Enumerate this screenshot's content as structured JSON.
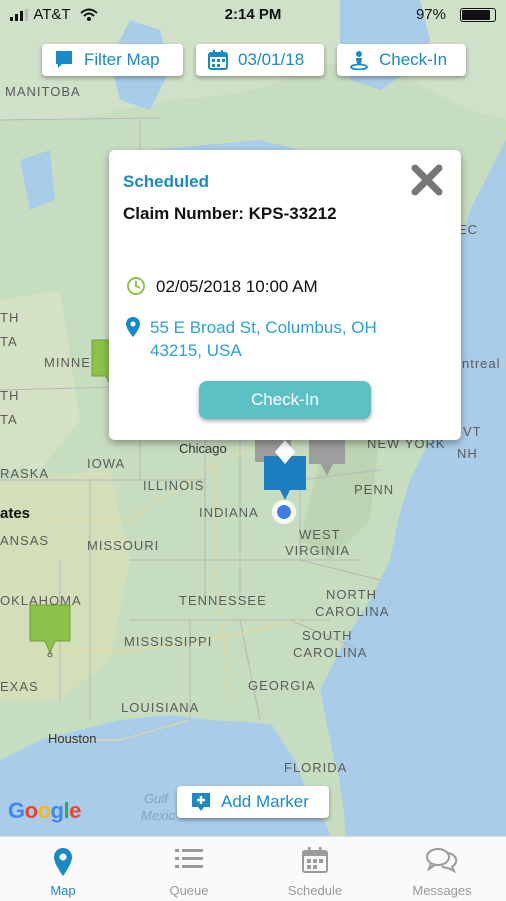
{
  "status_bar": {
    "carrier": "AT&T",
    "time": "2:14 PM",
    "battery": "97%"
  },
  "top_buttons": {
    "filter": "Filter Map",
    "date": "03/01/18",
    "checkin": "Check-In"
  },
  "map_labels": {
    "manitoba": "MANITOBA",
    "minne": "MINNE",
    "chicago": "Chicago",
    "iowa": "IOWA",
    "illinois": "ILLINOIS",
    "indiana": "INDIANA",
    "raska": "RASKA",
    "ates": "ates",
    "ansas": "ANSAS",
    "missouri": "MISSOURI",
    "oklahoma": "OKLAHOMA",
    "tennessee": "TENNESSEE",
    "mississippi": "MISSISSIPPI",
    "exas": "EXAS",
    "louisiana": "LOUISIANA",
    "houston": "Houston",
    "georgia": "GEORGIA",
    "florida": "FLORIDA",
    "penn": "PENN",
    "west": "WEST",
    "virginia": "VIRGINIA",
    "north": "NORTH",
    "ncarolina": "CAROLINA",
    "south": "SOUTH",
    "scarolina": "CAROLINA",
    "newyork": "NEW YORK",
    "ntreal": "ntreal",
    "ec": "EC",
    "vt": "VT",
    "nh": "NH",
    "th1": "TH",
    "ta1": "TA",
    "th2": "TH",
    "ta2": "TA",
    "gulf": "Gulf",
    "mexic": "Mexic"
  },
  "popup": {
    "status": "Scheduled",
    "claim": "Claim Number: KPS-33212",
    "datetime": "02/05/2018 10:00 AM",
    "address": "55 E Broad St, Columbus, OH 43215, USA",
    "checkin_label": "Check-In"
  },
  "add_marker": "Add Marker",
  "google": [
    "G",
    "o",
    "o",
    "g",
    "l",
    "e"
  ],
  "tabs": [
    {
      "label": "Map",
      "icon": "map-pin-icon",
      "active": true
    },
    {
      "label": "Queue",
      "icon": "list-icon",
      "active": false
    },
    {
      "label": "Schedule",
      "icon": "calendar-icon",
      "active": false
    },
    {
      "label": "Messages",
      "icon": "chat-bubbles-icon",
      "active": false
    }
  ],
  "colors": {
    "accent": "#1a8ac6",
    "checkin_button": "#5cc1c3",
    "marker_green": "#8bc34a",
    "marker_blue": "#1e7fc0",
    "marker_gray": "#9e9e9e"
  }
}
